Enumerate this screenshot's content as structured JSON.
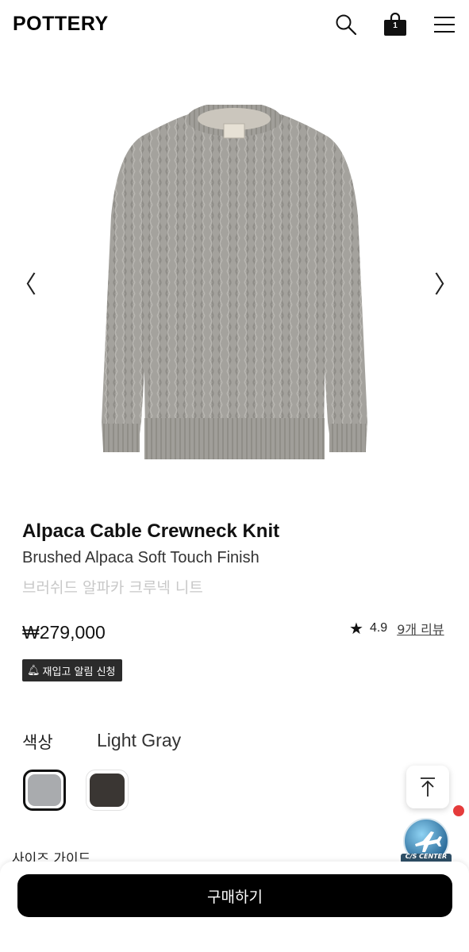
{
  "header": {
    "logo": "POTTERY",
    "cart_count": "1",
    "icons": [
      "search-icon",
      "shopping-bag-icon",
      "hamburger-menu-icon"
    ]
  },
  "gallery": {
    "prev_icon": "〈",
    "next_icon": "〉",
    "image": "gray-cable-knit-sweater"
  },
  "product": {
    "name": "Alpaca Cable Crewneck Knit",
    "subtitle": "Brushed Alpaca Soft Touch Finish",
    "korean_name": "브러쉬드 알파카 크루넥 니트",
    "price": "₩279,000",
    "rating": "4.9",
    "review_count": "9개 리뷰",
    "restock_label": "재입고 알림 신청"
  },
  "options": {
    "color_label": "색상",
    "selected_color": "Light Gray",
    "swatches": [
      {
        "name": "Light Gray",
        "color": "#a9abae",
        "selected": true
      },
      {
        "name": "Charcoal",
        "color": "#3a3633",
        "selected": false
      }
    ]
  },
  "floating": {
    "cs_label": "C/S CENTER"
  },
  "size_guide": "사이즈 가이드",
  "buy_button": "구매하기",
  "colors": {
    "primary": "#000000",
    "badge_red": "#e53b3b",
    "muted_text": "#c8c8c8"
  }
}
